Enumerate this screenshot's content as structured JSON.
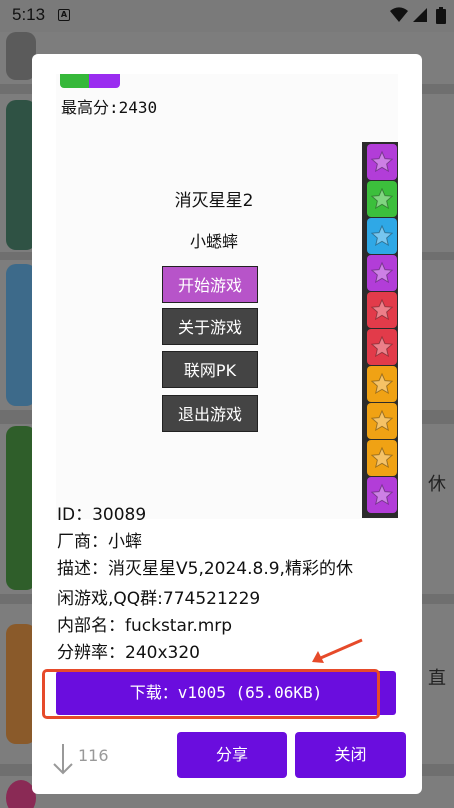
{
  "status_bar": {
    "time": "5:13",
    "notif_icon": "A"
  },
  "game_preview": {
    "high_score": "最高分:2430",
    "game_title": "消灭星星2",
    "game_author": "小蟋蟀",
    "menu": [
      "开始游戏",
      "关于游戏",
      "联网PK",
      "退出游戏"
    ],
    "star_colors": [
      "#b23dd8",
      "#3cbf3c",
      "#2fa8e6",
      "#b23dd8",
      "#e23b4a",
      "#e23b4a",
      "#f0a214",
      "#f0a214",
      "#f0a214",
      "#b23dd8"
    ]
  },
  "details": {
    "id": "ID：30089",
    "vendor": "厂商：小蟀",
    "desc_line1": "描述：消灭星星V5,2024.8.9,精彩的休",
    "desc_line2": "闲游戏,QQ群:774521229",
    "internal_name": "内部名：fuckstar.mrp",
    "resolution": "分辨率：240x320"
  },
  "download_button": {
    "label": "下载：v1005 (65.06KB)"
  },
  "download_count": "116",
  "buttons": {
    "share": "分享",
    "close": "关闭"
  },
  "background": {
    "peek_text_1": "休",
    "peek_text_2": "直"
  },
  "colors": {
    "accent": "#6a0dde",
    "highlight": "#e64a2a"
  }
}
